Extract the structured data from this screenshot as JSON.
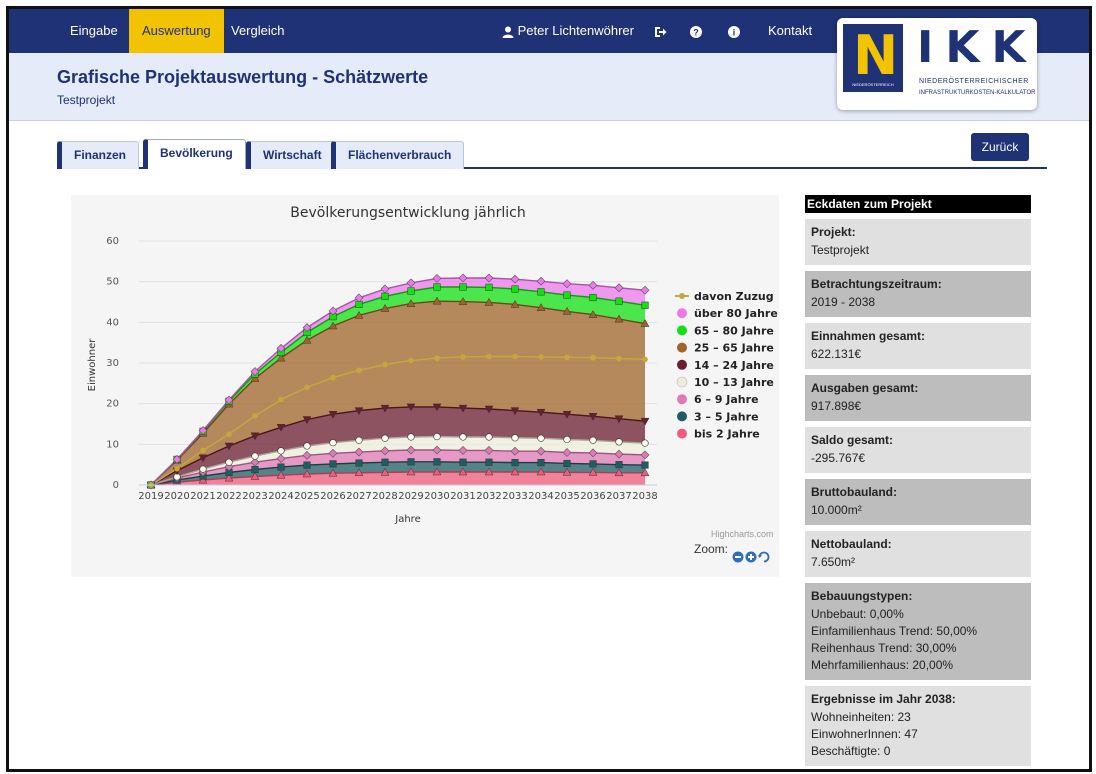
{
  "nav": {
    "items": [
      "Eingabe",
      "Auswertung",
      "Vergleich"
    ],
    "active_index": 1,
    "user": "Peter Lichtenwöhrer",
    "contact": "Kontakt"
  },
  "header": {
    "title": "Grafische Projektauswertung - Schätzwerte",
    "subtitle": "Testprojekt"
  },
  "logo": {
    "letter": "N",
    "name": "IKK",
    "badge": "NIEDERÖSTERREICH",
    "line1": "NIEDERÖSTERREICHISCHER",
    "line2": "INFRASTRUKTURKOSTEN-KALKULATOR"
  },
  "tabs": [
    "Finanzen",
    "Bevölkerung",
    "Wirtschaft",
    "Flächenverbrauch"
  ],
  "active_tab": 1,
  "back_button": "Zurück",
  "chart_data": {
    "type": "area",
    "title": "Bevölkerungsentwicklung jährlich",
    "xlabel": "Jahre",
    "ylabel": "Einwohner",
    "ylim": [
      0,
      60
    ],
    "yticks": [
      0,
      10,
      20,
      30,
      40,
      50,
      60
    ],
    "x": [
      "2019",
      "2020",
      "2021",
      "2022",
      "2023",
      "2024",
      "2025",
      "2026",
      "2027",
      "2028",
      "2029",
      "2030",
      "2031",
      "2032",
      "2033",
      "2034",
      "2035",
      "2036",
      "2037",
      "2038"
    ],
    "stacked_series": [
      {
        "name": "bis 2 Jahre",
        "color": "#f05a7b",
        "marker": "triangle",
        "values": [
          0,
          0.7,
          1.2,
          1.7,
          2.1,
          2.4,
          2.7,
          2.9,
          3.0,
          3.1,
          3.2,
          3.2,
          3.2,
          3.2,
          3.2,
          3.2,
          3.1,
          3.1,
          3.0,
          3.0
        ]
      },
      {
        "name": "3 – 5 Jahre",
        "color": "#1f5c63",
        "marker": "square",
        "values": [
          0,
          0.5,
          1.0,
          1.4,
          1.7,
          2.0,
          2.2,
          2.3,
          2.4,
          2.5,
          2.5,
          2.5,
          2.4,
          2.4,
          2.3,
          2.3,
          2.2,
          2.1,
          2.0,
          1.9
        ]
      },
      {
        "name": "6 – 9 Jahre",
        "color": "#e07ab4",
        "marker": "diamond",
        "values": [
          0,
          0.5,
          1.0,
          1.4,
          1.8,
          2.1,
          2.4,
          2.6,
          2.7,
          2.8,
          2.9,
          2.9,
          2.9,
          2.9,
          2.8,
          2.8,
          2.7,
          2.7,
          2.6,
          2.5
        ]
      },
      {
        "name": "10 – 13 Jahre",
        "color": "#ededdc",
        "marker": "circle",
        "values": [
          0,
          0.3,
          0.7,
          1.1,
          1.5,
          1.9,
          2.3,
          2.6,
          2.9,
          3.1,
          3.2,
          3.3,
          3.3,
          3.3,
          3.3,
          3.2,
          3.2,
          3.1,
          3.0,
          2.9
        ]
      },
      {
        "name": "14 – 24 Jahre",
        "color": "#6b1c2e",
        "marker": "triangle-down",
        "values": [
          0,
          1.5,
          2.8,
          4.0,
          5.0,
          5.8,
          6.5,
          7.0,
          7.3,
          7.4,
          7.4,
          7.3,
          7.1,
          6.9,
          6.7,
          6.4,
          6.2,
          5.9,
          5.7,
          5.4
        ]
      },
      {
        "name": "25 – 65 Jahre",
        "color": "#a0642a",
        "marker": "triangle",
        "values": [
          0,
          2.6,
          6.0,
          10.3,
          14.1,
          17.0,
          19.5,
          21.7,
          23.4,
          24.5,
          25.4,
          26.0,
          26.2,
          26.2,
          26.1,
          25.7,
          25.3,
          25.0,
          24.5,
          24.0
        ]
      },
      {
        "name": "65 – 80 Jahre",
        "color": "#12e012",
        "marker": "square",
        "values": [
          0,
          0.2,
          0.5,
          0.7,
          1.1,
          1.4,
          1.9,
          2.3,
          2.7,
          3.0,
          3.1,
          3.5,
          3.6,
          3.7,
          3.8,
          3.9,
          4.0,
          4.2,
          4.4,
          4.5
        ]
      },
      {
        "name": "über 80 Jahre",
        "color": "#ee77ee",
        "marker": "diamond",
        "values": [
          0,
          0,
          0.2,
          0.3,
          0.6,
          1.0,
          1.2,
          1.4,
          1.6,
          1.8,
          2.0,
          2.1,
          2.2,
          2.3,
          2.4,
          2.6,
          2.8,
          3.0,
          3.3,
          3.7
        ]
      }
    ],
    "line_series": {
      "name": "davon Zuzug",
      "color": "#c3a93c",
      "marker": "circle",
      "values": [
        0,
        4,
        8.5,
        12.5,
        17,
        21,
        24,
        26.4,
        28.2,
        29.6,
        30.6,
        31.2,
        31.5,
        31.6,
        31.6,
        31.5,
        31.4,
        31.3,
        31.1,
        30.9
      ]
    },
    "legend_order": [
      "davon Zuzug",
      "über 80 Jahre",
      "65 – 80 Jahre",
      "25 – 65 Jahre",
      "14 – 24 Jahre",
      "10 – 13 Jahre",
      "6 – 9 Jahre",
      "3 – 5 Jahre",
      "bis 2 Jahre"
    ],
    "legend_position": "right",
    "credits": "Highcharts.com",
    "zoom_label": "Zoom:"
  },
  "side": {
    "title": "Eckdaten zum Projekt",
    "cards": [
      {
        "label": "Projekt:",
        "lines": [
          "Testprojekt"
        ]
      },
      {
        "label": "Betrachtungszeitraum:",
        "lines": [
          "2019 - 2038"
        ]
      },
      {
        "label": "Einnahmen gesamt:",
        "lines": [
          "622.131€"
        ]
      },
      {
        "label": "Ausgaben gesamt:",
        "lines": [
          "917.898€"
        ]
      },
      {
        "label": "Saldo gesamt:",
        "lines": [
          "-295.767€"
        ]
      },
      {
        "label": "Bruttobauland:",
        "lines": [
          "10.000m²"
        ]
      },
      {
        "label": "Nettobauland:",
        "lines": [
          "7.650m²"
        ]
      },
      {
        "label": "Bebauungstypen:",
        "lines": [
          "Unbebaut: 0,00%",
          "Einfamilienhaus Trend: 50,00%",
          "Reihenhaus Trend: 30,00%",
          "Mehrfamilienhaus: 20,00%"
        ]
      },
      {
        "label": "Ergebnisse im Jahr 2038:",
        "lines": [
          "Wohneinheiten: 23",
          "EinwohnerInnen: 47",
          "Beschäftigte: 0"
        ]
      }
    ]
  }
}
